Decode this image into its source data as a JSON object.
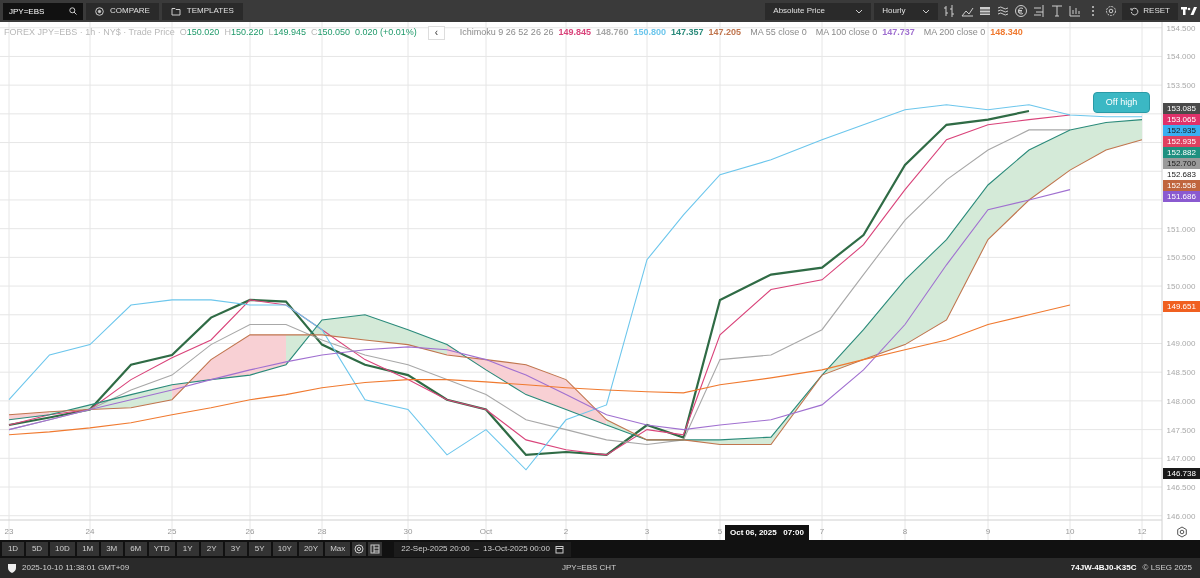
{
  "toolbar": {
    "symbol": "JPY=EBS",
    "buttons": [
      "COMPARE",
      "TEMPLATES"
    ],
    "price_mode": "Absolute Price",
    "interval": "Hourly",
    "reset": "RESET"
  },
  "legend": {
    "instrument": "FOREX JPY=EBS · 1h · NY$ · Trade Price",
    "ohlc": [
      {
        "label": "O",
        "value": "150.020"
      },
      {
        "label": "H",
        "value": "150.220"
      },
      {
        "label": "L",
        "value": "149.945"
      },
      {
        "label": "C",
        "value": "150.050"
      }
    ],
    "change": "0.020 (+0.01%)",
    "collapse": "‹",
    "indicators": [
      {
        "name": "Ichimoku 9 26 52 26 26",
        "values": [
          "149.845",
          "148.760",
          "150.800",
          "147.357",
          "147.205"
        ]
      },
      {
        "name": "MA 55 close 0"
      },
      {
        "name": "MA 100 close 0",
        "values": [
          "147.737"
        ]
      },
      {
        "name": "MA 200 close 0",
        "values": [
          "148.340"
        ]
      }
    ]
  },
  "chart": {
    "chart_data": {
      "type": "line",
      "categories": [
        "23",
        null,
        "24",
        null,
        "25",
        null,
        "26",
        null,
        "28",
        null,
        "30",
        null,
        "Oct",
        null,
        "2",
        null,
        "3",
        null,
        "5",
        null,
        "7",
        null,
        "8",
        null,
        "9",
        null,
        "10",
        null,
        "12"
      ],
      "ylim": [
        145.96,
        154.6
      ],
      "grid": true,
      "yticks": [
        {
          "value": 146,
          "label": "146.000"
        },
        {
          "value": 146.5,
          "label": "146.500"
        },
        {
          "value": 147,
          "label": "147.000"
        },
        {
          "value": 147.5,
          "label": "147.500"
        },
        {
          "value": 148,
          "label": "148.000"
        },
        {
          "value": 148.5,
          "label": "148.500"
        },
        {
          "value": 149,
          "label": "149.000"
        },
        {
          "value": 150,
          "label": "150.000"
        },
        {
          "value": 150.5,
          "label": "150.500"
        },
        {
          "value": 151,
          "label": "151.000"
        },
        {
          "value": 153.5,
          "label": "153.500"
        },
        {
          "value": 154,
          "label": "154.000"
        },
        {
          "value": 154.5,
          "label": "154.500"
        }
      ],
      "series": [
        {
          "color": "#2f6b45",
          "values": [
            147.58,
            147.71,
            147.85,
            148.63,
            148.8,
            149.45,
            149.76,
            149.73,
            148.98,
            148.63,
            148.45,
            148.02,
            147.85,
            147.06,
            147.11,
            147.06,
            147.58,
            147.36,
            149.76,
            150.2,
            150.32,
            150.89,
            152.11,
            152.81,
            152.9,
            153.05,
            null,
            null,
            null
          ]
        },
        {
          "color": "#d9437a",
          "values": [
            147.58,
            147.76,
            147.85,
            148.37,
            148.75,
            149.06,
            149.76,
            149.67,
            149.24,
            148.72,
            148.37,
            148.02,
            147.85,
            147.32,
            147.15,
            147.06,
            147.5,
            147.41,
            149.15,
            149.94,
            150.11,
            150.72,
            151.68,
            152.55,
            152.81,
            152.9,
            152.98,
            null,
            null
          ]
        },
        {
          "color": "#a8a8a8",
          "values": [
            147.5,
            147.67,
            147.85,
            148.19,
            148.45,
            148.98,
            149.33,
            149.33,
            149.06,
            148.8,
            148.63,
            148.37,
            148.11,
            147.67,
            147.5,
            147.32,
            147.24,
            147.32,
            148.72,
            148.8,
            149.24,
            150.2,
            151.15,
            151.85,
            152.37,
            152.72,
            152.72,
            null,
            null
          ]
        },
        {
          "color": "#6cc6ec",
          "values": [
            148.02,
            148.8,
            148.98,
            149.67,
            149.76,
            149.76,
            149.67,
            149.67,
            149.24,
            148.02,
            147.85,
            147.06,
            147.5,
            146.8,
            147.67,
            147.93,
            150.46,
            151.24,
            151.94,
            152.2,
            152.55,
            152.81,
            153.07,
            153.16,
            153.07,
            153.16,
            152.98,
            152.95,
            152.95
          ]
        },
        {
          "color": "#2a8a7a",
          "values": [
            147.67,
            147.76,
            147.93,
            148.11,
            148.28,
            148.37,
            148.45,
            148.63,
            149.41,
            149.5,
            149.24,
            148.98,
            148.54,
            148.11,
            147.85,
            147.58,
            147.32,
            147.32,
            147.32,
            147.37,
            148.45,
            149.24,
            150.11,
            150.81,
            151.76,
            152.37,
            152.72,
            152.85,
            152.9
          ]
        },
        {
          "color": "#c0754e",
          "values": [
            147.76,
            147.81,
            147.85,
            147.88,
            148.02,
            148.72,
            149.15,
            149.15,
            149.15,
            149.06,
            148.98,
            148.8,
            148.72,
            148.63,
            148.37,
            147.67,
            147.32,
            147.32,
            147.24,
            147.24,
            148.45,
            148.72,
            148.98,
            149.41,
            150.81,
            151.5,
            152.02,
            152.37,
            152.55
          ]
        },
        {
          "color": "#a070d0",
          "values": [
            147.5,
            147.67,
            147.85,
            148.02,
            148.19,
            148.37,
            148.54,
            148.68,
            148.8,
            148.89,
            148.94,
            148.89,
            148.72,
            148.45,
            148.11,
            147.76,
            147.58,
            147.5,
            147.58,
            147.67,
            147.93,
            148.54,
            149.33,
            150.37,
            151.33,
            151.5,
            151.68,
            null,
            null
          ]
        },
        {
          "color": "#f07a30",
          "values": [
            147.41,
            147.46,
            147.53,
            147.62,
            147.76,
            147.88,
            148.02,
            148.11,
            148.23,
            148.32,
            148.37,
            148.37,
            148.33,
            148.28,
            148.23,
            148.19,
            148.16,
            148.14,
            148.28,
            148.4,
            148.54,
            148.72,
            148.89,
            149.06,
            149.33,
            149.5,
            149.67,
            null,
            null
          ]
        }
      ]
    },
    "price_labels": [
      {
        "text": "153.085",
        "color": "#4a4a4a"
      },
      {
        "text": "153.065",
        "color": "#e0306a"
      },
      {
        "text": "152.935",
        "color": "#39aef0"
      },
      {
        "text": "152.935",
        "color": "#e04060"
      },
      {
        "text": "152.882",
        "color": "#1f9080"
      },
      {
        "text": "152.700",
        "color": "#9a9a9a"
      },
      {
        "text": "152.683",
        "color": "#ffffff"
      },
      {
        "text": "152.558",
        "color": "#c0653e"
      },
      {
        "text": "151.686",
        "color": "#8a5ad0"
      },
      {
        "text": "149.651",
        "color": "#f06020"
      },
      {
        "text": "146.738",
        "color": "#1a1a1a"
      }
    ],
    "badge": "Off high",
    "tooltip": "Oct 06, 2025   07:00"
  },
  "range_bar": {
    "ranges": [
      "1D",
      "5D",
      "10D",
      "1M",
      "3M",
      "6M",
      "YTD",
      "1Y",
      "2Y",
      "3Y",
      "5Y",
      "10Y",
      "20Y",
      "Max"
    ],
    "date_range": "22-Sep-2025 20:00  –  13-Oct-2025 00:00"
  },
  "status_bar": {
    "timestamp": "2025-10-10 11:38:01 GMT+09",
    "center": "JPY=EBS CHT",
    "code": "74JW-4BJ0-K35C",
    "copyright": "© LSEG 2025"
  }
}
